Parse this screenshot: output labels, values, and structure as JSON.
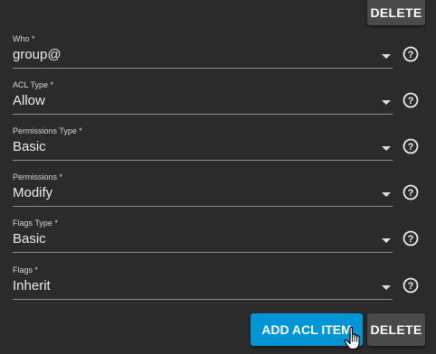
{
  "buttons": {
    "delete_top": "DELETE",
    "add_acl_item": "ADD ACL ITEM",
    "delete_bottom": "DELETE"
  },
  "fields": [
    {
      "label": "Who *",
      "value": "group@"
    },
    {
      "label": "ACL Type *",
      "value": "Allow"
    },
    {
      "label": "Permissions Type *",
      "value": "Basic"
    },
    {
      "label": "Permissions *",
      "value": "Modify"
    },
    {
      "label": "Flags Type *",
      "value": "Basic"
    },
    {
      "label": "Flags *",
      "value": "Inherit"
    }
  ],
  "icons": {
    "dropdown": "chevron-down-icon",
    "help": "help-circle-icon",
    "cursor": "hand-pointer-icon"
  },
  "colors": {
    "background": "#2b2b2b",
    "primary_button": "#0095d5",
    "secondary_button": "#4a4a4a"
  }
}
